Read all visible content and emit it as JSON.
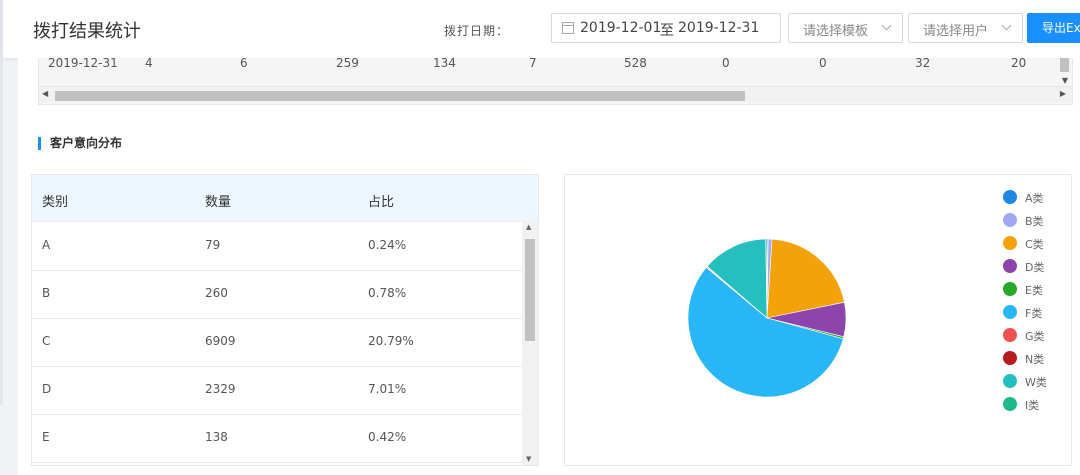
{
  "header": {
    "title": "拨打结果统计",
    "date_label": "拨打日期：",
    "date_start": "2019-12-01",
    "date_sep": "至",
    "date_end": "2019-12-31",
    "template_placeholder": "请选择模板",
    "user_placeholder": "请选择用户",
    "export_label": "导出Exc"
  },
  "top_table_row": [
    "2019-12-31",
    "4",
    "6",
    "259",
    "134",
    "7",
    "528",
    "0",
    "0",
    "32",
    "20"
  ],
  "section_title": "客户意向分布",
  "dist_table": {
    "headers": [
      "类别",
      "数量",
      "占比"
    ],
    "rows": [
      [
        "A",
        "79",
        "0.24%"
      ],
      [
        "B",
        "260",
        "0.78%"
      ],
      [
        "C",
        "6909",
        "20.79%"
      ],
      [
        "D",
        "2329",
        "7.01%"
      ],
      [
        "E",
        "138",
        "0.42%"
      ]
    ]
  },
  "chart_data": {
    "type": "pie",
    "title": "",
    "legend_position": "right",
    "slices": [
      {
        "name": "A类",
        "value": 0.24,
        "color": "#1e88e5"
      },
      {
        "name": "B类",
        "value": 0.78,
        "color": "#9fa8f0"
      },
      {
        "name": "C类",
        "value": 20.79,
        "color": "#f4a20a"
      },
      {
        "name": "D类",
        "value": 7.01,
        "color": "#8e44ad"
      },
      {
        "name": "E类",
        "value": 0.42,
        "color": "#27a827"
      },
      {
        "name": "F类",
        "value": 56.8,
        "color": "#29b6f6"
      },
      {
        "name": "G类",
        "value": 0.2,
        "color": "#ef5350"
      },
      {
        "name": "N类",
        "value": 0.1,
        "color": "#b71c1c"
      },
      {
        "name": "W类",
        "value": 13.4,
        "color": "#26bfbf"
      },
      {
        "name": "I类",
        "value": 0.26,
        "color": "#1fb88a"
      }
    ]
  }
}
